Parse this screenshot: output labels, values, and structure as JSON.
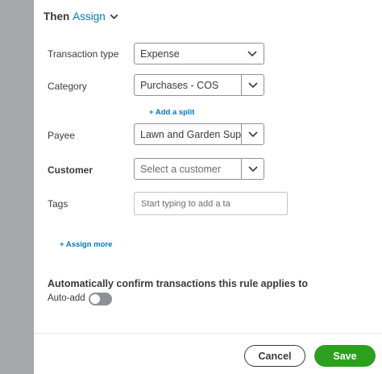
{
  "colors": {
    "link": "#0077c5",
    "primary_button": "#2ca01c",
    "side_overlay": "#a6a8ab"
  },
  "header": {
    "then_label": "Then",
    "assign_label": "Assign",
    "assign_icon": "chevron-down-icon"
  },
  "fields": {
    "transaction_type": {
      "label": "Transaction type",
      "value": "Expense"
    },
    "category": {
      "label": "Category",
      "value": "Purchases - COS"
    },
    "add_split_label": "+ Add a split",
    "payee": {
      "label": "Payee",
      "value": "Lawn and Garden Supp"
    },
    "customer": {
      "label": "Customer",
      "placeholder": "Select a customer"
    },
    "tags": {
      "label": "Tags",
      "placeholder": "Start typing to add a ta"
    }
  },
  "assign_more_label": "+ Assign more",
  "auto_confirm": {
    "heading": "Automatically confirm transactions this rule applies to",
    "auto_add_label": "Auto-add",
    "auto_add_enabled": false
  },
  "footer": {
    "cancel_label": "Cancel",
    "save_label": "Save"
  }
}
